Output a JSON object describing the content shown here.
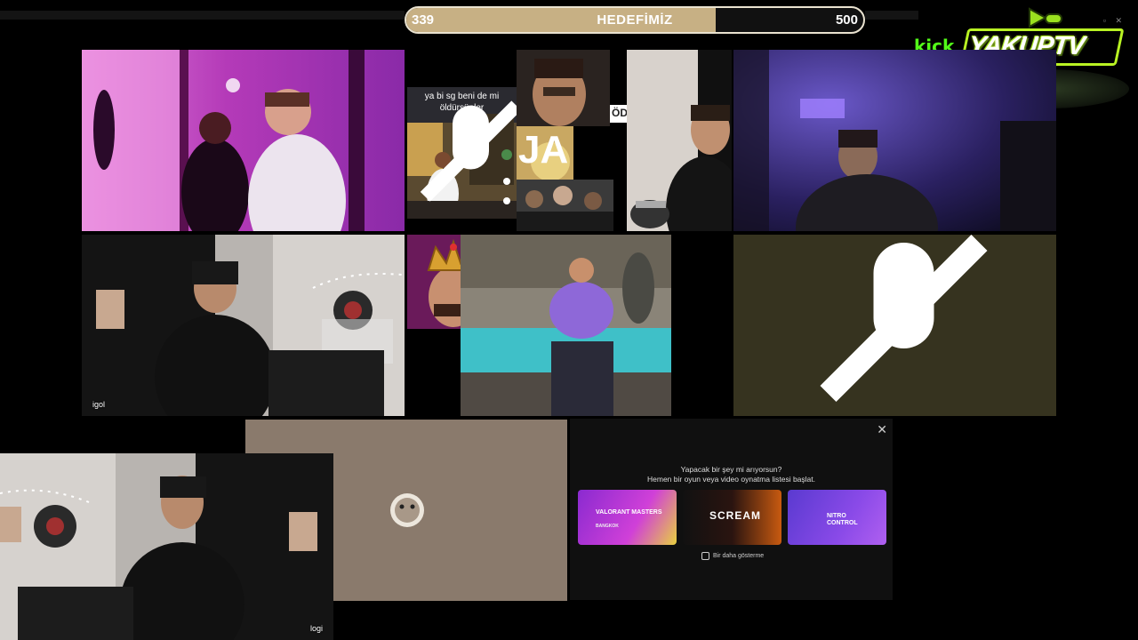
{
  "goal": {
    "current": "339",
    "title": "HEDEFİMİZ",
    "target": "500",
    "progress": 0.678
  },
  "logo": {
    "kick": "kick",
    "brand": "YAKUPTV"
  },
  "tiles": {
    "tile_tiktok_caption": "ya bi sg beni de mi öldürsünler",
    "tile_ja": "JA",
    "tile_od": "ÖD",
    "tile_cam2_label": "igol",
    "tile_bottom_label": "logi"
  },
  "panel": {
    "question_line1": "Yapacak bir şey mi arıyorsun?",
    "question_line2": "Hemen bir oyun veya video oynatma listesi başlat.",
    "cards": [
      {
        "name": "VALORANT MASTERS",
        "sub": "BANGKOK"
      },
      {
        "name": "SCREAM"
      },
      {
        "name": "NITRO CONTROL"
      }
    ],
    "checkbox_label": "Bir daha gösterme"
  },
  "colors": {
    "goal_fill": "#c7b084",
    "kick_green": "#53fc18",
    "brand_lime": "#b9f323",
    "panel_bg": "#101010"
  }
}
